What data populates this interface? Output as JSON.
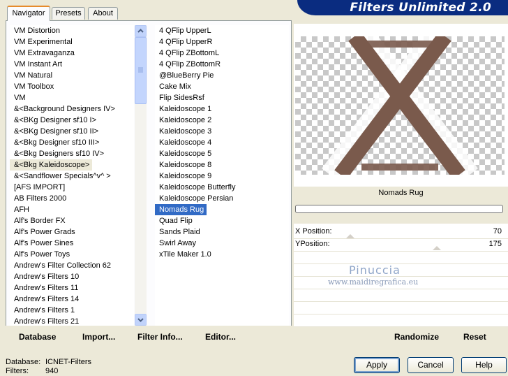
{
  "app": {
    "title": "Filters Unlimited 2.0"
  },
  "tabs": [
    {
      "label": "Navigator",
      "active": true
    },
    {
      "label": "Presets",
      "active": false
    },
    {
      "label": "About",
      "active": false
    }
  ],
  "categories": [
    {
      "label": "VM Distortion"
    },
    {
      "label": "VM Experimental"
    },
    {
      "label": "VM Extravaganza"
    },
    {
      "label": "VM Instant Art"
    },
    {
      "label": "VM Natural"
    },
    {
      "label": "VM Toolbox"
    },
    {
      "label": "VM"
    },
    {
      "label": "&<Background Designers IV>"
    },
    {
      "label": "&<BKg Designer sf10 I>"
    },
    {
      "label": "&<BKg Designer sf10 II>"
    },
    {
      "label": "&<Bkg Designer sf10 III>"
    },
    {
      "label": "&<Bkg Designers sf10 IV>"
    },
    {
      "label": "&<Bkg Kaleidoscope>",
      "state": "current"
    },
    {
      "label": "&<Sandflower Specials^v^ >"
    },
    {
      "label": "[AFS IMPORT]"
    },
    {
      "label": "AB Filters 2000"
    },
    {
      "label": "AFH"
    },
    {
      "label": "Alf's Border FX"
    },
    {
      "label": "Alf's Power Grads"
    },
    {
      "label": "Alf's Power Sines"
    },
    {
      "label": "Alf's Power Toys"
    },
    {
      "label": "Andrew's Filter Collection 62"
    },
    {
      "label": "Andrew's Filters 10"
    },
    {
      "label": "Andrew's Filters 11"
    },
    {
      "label": "Andrew's Filters 14"
    },
    {
      "label": "Andrew's Filters 1"
    },
    {
      "label": "Andrew's Filters 21"
    }
  ],
  "filters": [
    {
      "label": "4 QFlip UpperL"
    },
    {
      "label": "4 QFlip UpperR"
    },
    {
      "label": "4 QFlip ZBottomL"
    },
    {
      "label": "4 QFlip ZBottomR"
    },
    {
      "label": "@BlueBerry Pie"
    },
    {
      "label": "Cake Mix"
    },
    {
      "label": "Flip SidesRsf"
    },
    {
      "label": "Kaleidoscope 1"
    },
    {
      "label": "Kaleidoscope 2"
    },
    {
      "label": "Kaleidoscope 3"
    },
    {
      "label": "Kaleidoscope 4"
    },
    {
      "label": "Kaleidoscope 5"
    },
    {
      "label": "Kaleidoscope 8"
    },
    {
      "label": "Kaleidoscope 9"
    },
    {
      "label": "Kaleidoscope Butterfly"
    },
    {
      "label": "Kaleidoscope Persian"
    },
    {
      "label": "Nomads Rug",
      "state": "selected"
    },
    {
      "label": "Quad Flip"
    },
    {
      "label": "Sands Plaid"
    },
    {
      "label": "Swirl Away"
    },
    {
      "label": "xTile Maker 1.0"
    }
  ],
  "toolbar": {
    "database": "Database",
    "import": "Import...",
    "filter_info": "Filter Info...",
    "editor": "Editor..."
  },
  "preview": {
    "filter_name": "Nomads Rug",
    "accent_color": "#7a5a4c"
  },
  "params": [
    {
      "label": "X Position:",
      "value": "70"
    },
    {
      "label": "YPosition:",
      "value": "175"
    }
  ],
  "watermark": {
    "line1": "Pinuccia",
    "line2": "www.maidiregrafica.eu"
  },
  "preview_actions": {
    "randomize": "Randomize",
    "reset": "Reset"
  },
  "status": {
    "database_label": "Database:",
    "database_value": "ICNET-Filters",
    "filters_label": "Filters:",
    "filters_value": "940"
  },
  "buttons": {
    "apply": "Apply",
    "cancel": "Cancel",
    "help": "Help"
  }
}
